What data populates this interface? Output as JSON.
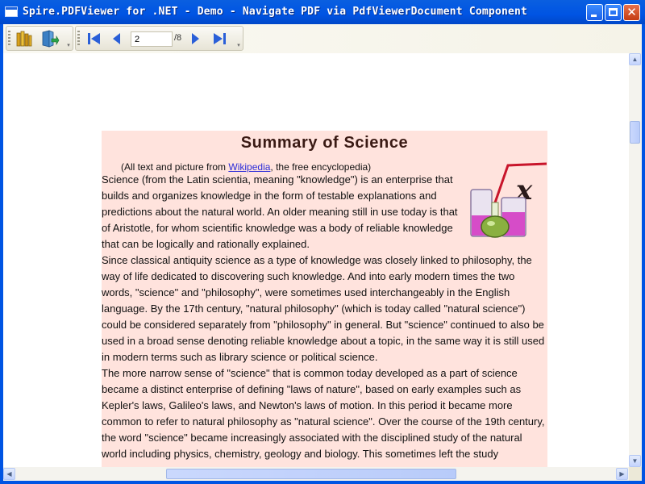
{
  "window": {
    "title": "Spire.PDFViewer for .NET - Demo - Navigate PDF via PdfViewerDocument Component",
    "controls": {
      "minimize_icon": "minimize-icon",
      "maximize_icon": "maximize-icon",
      "close_icon": "close-icon",
      "close_glyph": "✕"
    }
  },
  "toolbar": {
    "file_group": {
      "open_icon": "open-folder-icon",
      "save_icon": "save-icon",
      "overflow_glyph": "▾"
    },
    "nav_group": {
      "first_icon": "first-page-icon",
      "prev_icon": "previous-page-icon",
      "current_page": "2",
      "total_pages": "/8",
      "next_icon": "next-page-icon",
      "last_icon": "last-page-icon",
      "overflow_glyph": "▾"
    }
  },
  "document": {
    "title": "Summary of Science",
    "credit_prefix": "(All text and picture from ",
    "credit_link": "Wikipedia",
    "credit_suffix": ", the free encyclopedia)",
    "paragraph1": "Science (from the Latin scientia, meaning \"knowledge\") is an enterprise that builds and organizes knowledge in the form of testable explanations and predictions about the natural world. An older meaning still in use today is that of Aristotle, for whom scientific knowledge was a body of reliable knowledge that can be logically and rationally explained.",
    "paragraph2": "Since classical antiquity science as a type of knowledge was closely linked to philosophy, the way of life dedicated to discovering such knowledge. And into early modern times the two words, \"science\" and \"philosophy\", were sometimes used interchangeably in the English language. By the 17th century, \"natural philosophy\" (which is today called \"natural science\") could be considered separately from \"philosophy\" in general. But \"science\" continued to also be used in a broad sense denoting reliable knowledge about a topic, in the same way it is still used in modern terms such as library science or political science.",
    "paragraph3": "The more narrow sense of \"science\" that is common today developed as a part of science became a distinct enterprise of defining \"laws of nature\", based on early examples such as Kepler's laws, Galileo's laws, and Newton's laws of motion. In this period it became more common to refer to natural philosophy as \"natural science\". Over the course of the 19th century, the word \"science\" became increasingly associated with the disciplined study of the natural world including physics, chemistry, geology and biology. This sometimes left the study",
    "image_icon": "science-beakers-image"
  },
  "scrollbars": {
    "up_glyph": "▲",
    "down_glyph": "▼",
    "left_glyph": "◀",
    "right_glyph": "▶"
  },
  "colors": {
    "titlebar": "#0054e3",
    "page_background": "#ffe3dd",
    "link": "#2d2dd8",
    "nav_arrow": "#2a5fd8"
  }
}
